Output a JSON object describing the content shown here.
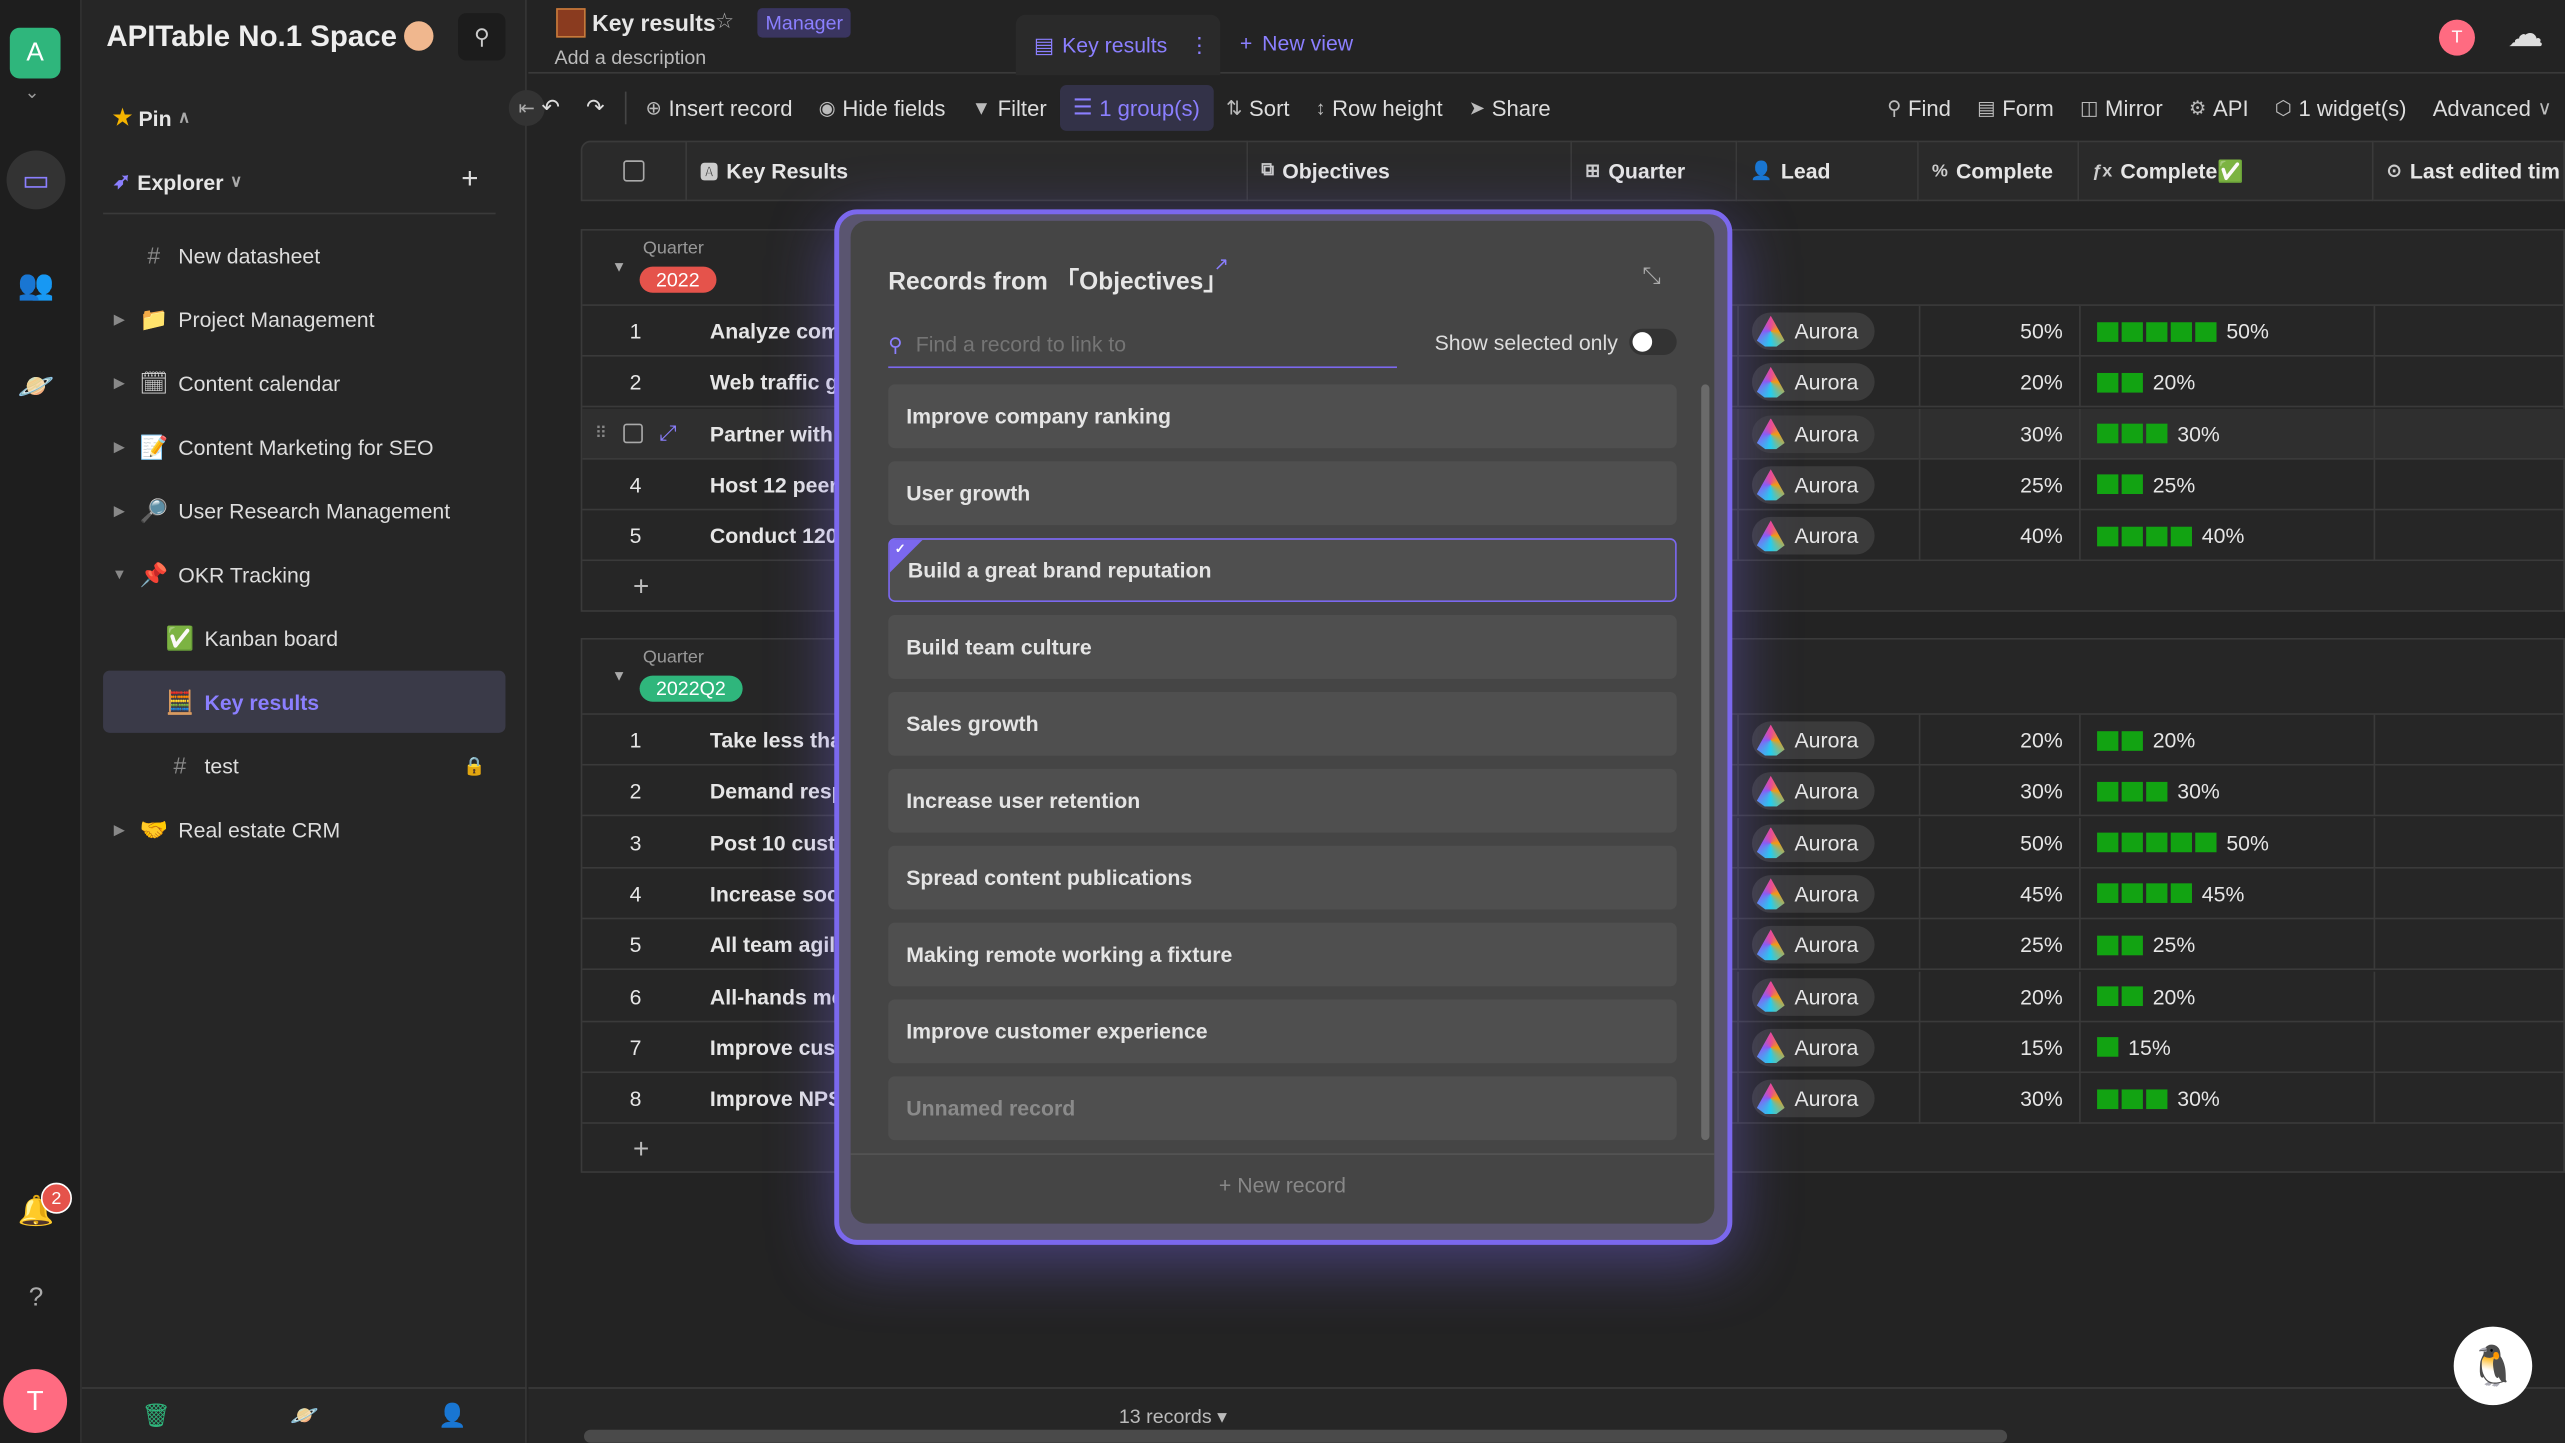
{
  "rail": {
    "workspace_initial": "A",
    "notification_count": "2",
    "user_initial": "T"
  },
  "sidebar": {
    "space_title": "APITable No.1 Space",
    "pin_label": "Pin",
    "explorer_label": "Explorer",
    "items": [
      {
        "label": "New datasheet",
        "icon": "hash-icon",
        "glyph": "#",
        "arrow": ""
      },
      {
        "label": "Project Management",
        "icon": "folder-icon",
        "glyph": "📁",
        "arrow": "▶"
      },
      {
        "label": "Content calendar",
        "icon": "calendar-icon",
        "glyph": "🗓",
        "arrow": "▶"
      },
      {
        "label": "Content Marketing for SEO",
        "icon": "memo-icon",
        "glyph": "📝",
        "arrow": "▶"
      },
      {
        "label": "User Research Management",
        "icon": "magnifier-icon",
        "glyph": "🔎",
        "arrow": "▶"
      },
      {
        "label": "OKR Tracking",
        "icon": "pushpin-icon",
        "glyph": "📌",
        "arrow": "▼"
      },
      {
        "label": "Kanban board",
        "icon": "check-icon",
        "glyph": "✅",
        "arrow": "",
        "indent": true
      },
      {
        "label": "Key results",
        "icon": "abacus-icon",
        "glyph": "🧮",
        "arrow": "",
        "indent": true,
        "active": true
      },
      {
        "label": "test",
        "icon": "hash-icon",
        "glyph": "#",
        "arrow": "",
        "indent": true,
        "locked": true
      },
      {
        "label": "Real estate CRM",
        "icon": "handshake-icon",
        "glyph": "🤝",
        "arrow": "▶"
      }
    ]
  },
  "header": {
    "title": "Key results",
    "role_badge": "Manager",
    "description": "Add a description",
    "view_tab": "Key results",
    "new_view": "New view"
  },
  "toolbar": {
    "insert": "Insert record",
    "hide": "Hide fields",
    "filter": "Filter",
    "group": "1 group(s)",
    "sort": "Sort",
    "row_height": "Row height",
    "share": "Share",
    "find": "Find",
    "form": "Form",
    "mirror": "Mirror",
    "api": "API",
    "widgets": "1 widget(s)",
    "advanced": "Advanced"
  },
  "columns": [
    "Key Results",
    "Objectives",
    "Quarter",
    "Lead",
    "Complete",
    "Complete✅",
    "Last edited tim"
  ],
  "groups": [
    {
      "field": "Quarter",
      "value": "2022",
      "color": "#e5534b",
      "rows": [
        {
          "n": "1",
          "name": "Analyze com",
          "lead": "Aurora",
          "pct": 50
        },
        {
          "n": "2",
          "name": "Web traffic gro",
          "lead": "Aurora",
          "pct": 20
        },
        {
          "n": "3",
          "name": "Partner with a",
          "lead": "Aurora",
          "pct": 30,
          "hover": true
        },
        {
          "n": "4",
          "name": "Host 12 peer-t",
          "lead": "Aurora",
          "pct": 25
        },
        {
          "n": "5",
          "name": "Conduct 120 c",
          "lead": "Aurora",
          "pct": 40
        }
      ]
    },
    {
      "field": "Quarter",
      "value": "2022Q2",
      "color": "#2fb67c",
      "rows": [
        {
          "n": "1",
          "name": "Take less than",
          "lead": "Aurora",
          "pct": 20
        },
        {
          "n": "2",
          "name": "Demand respo",
          "lead": "Aurora",
          "pct": 30
        },
        {
          "n": "3",
          "name": "Post 10 custom",
          "lead": "Aurora",
          "pct": 50
        },
        {
          "n": "4",
          "name": "Increase socia",
          "lead": "Aurora",
          "pct": 45
        },
        {
          "n": "5",
          "name": "All team agile",
          "lead": "Aurora",
          "pct": 25
        },
        {
          "n": "6",
          "name": "All-hands mee",
          "lead": "Aurora",
          "pct": 20
        },
        {
          "n": "7",
          "name": "Improve custo",
          "lead": "Aurora",
          "pct": 15
        },
        {
          "n": "8",
          "name": "Improve NPS r",
          "lead": "Aurora",
          "pct": 30
        }
      ]
    }
  ],
  "modal": {
    "title": "Records from 「Objectives」",
    "search_placeholder": "Find a record to link to",
    "show_selected": "Show selected only",
    "new_record": "+ New record",
    "records": [
      {
        "label": "Improve company ranking"
      },
      {
        "label": "User growth"
      },
      {
        "label": "Build a great brand reputation",
        "selected": true
      },
      {
        "label": "Build team culture"
      },
      {
        "label": "Sales growth"
      },
      {
        "label": "Increase user retention"
      },
      {
        "label": "Spread content publications"
      },
      {
        "label": "Making remote working a fixture"
      },
      {
        "label": "Improve customer experience"
      },
      {
        "label": "Unnamed record",
        "unnamed": true
      }
    ]
  },
  "footer": {
    "count": "13 records ▾"
  },
  "colors": {
    "accent": "#7b68ee",
    "progress": "#12a312"
  }
}
